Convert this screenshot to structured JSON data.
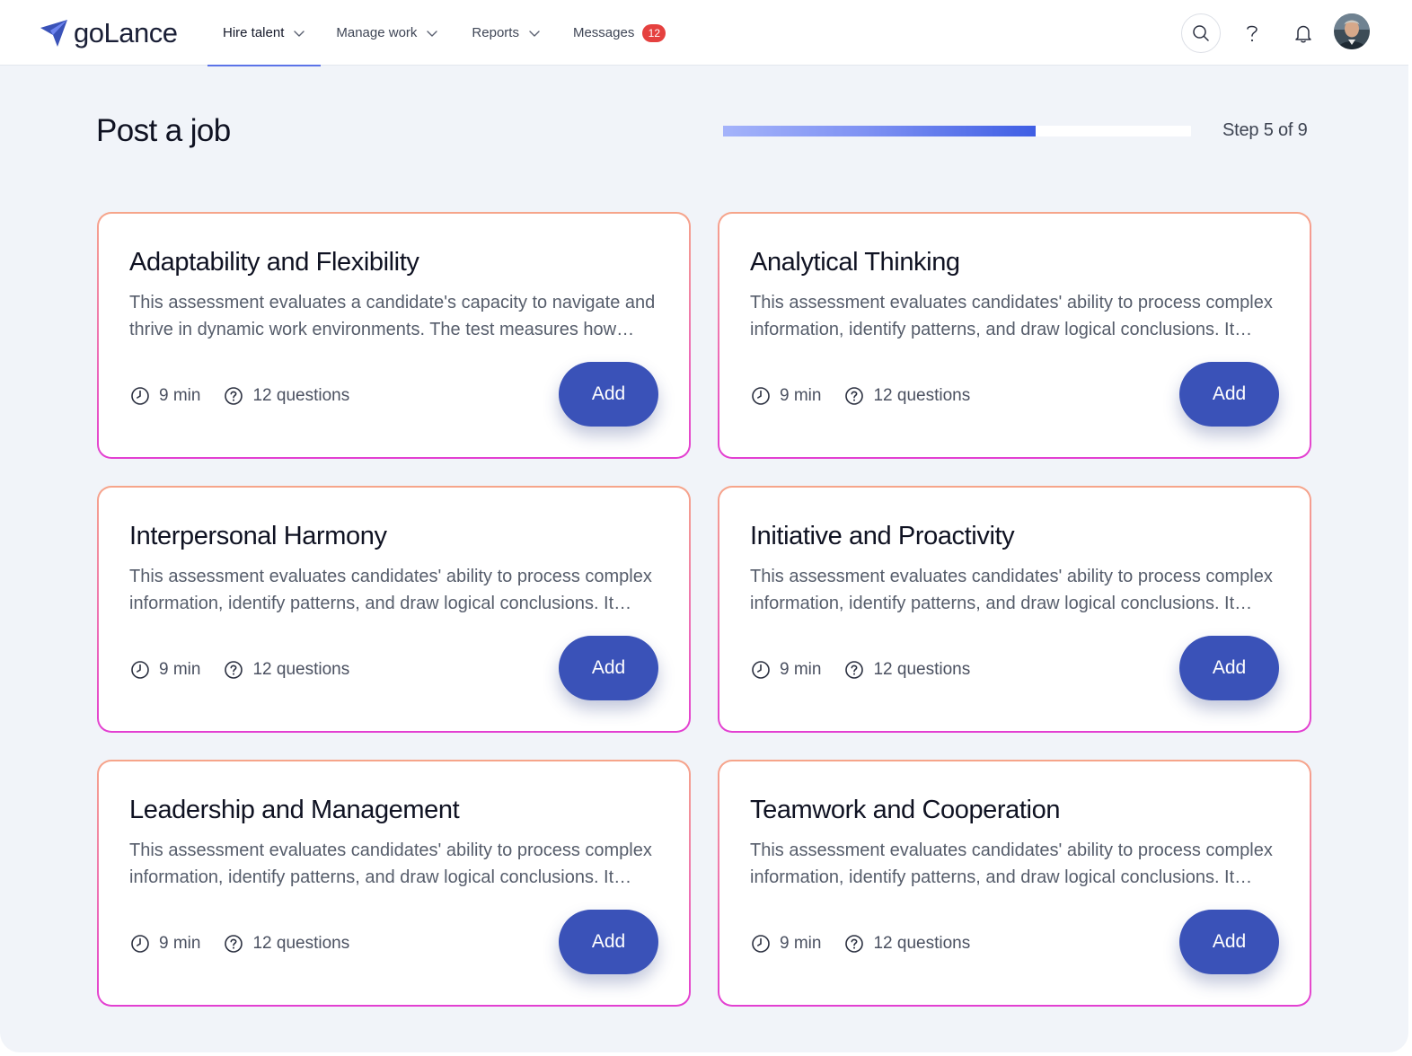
{
  "brand": {
    "name": "goLance",
    "accent": "#3a52b8"
  },
  "nav": {
    "items": [
      {
        "label": "Hire talent",
        "active": true,
        "dropdown": true
      },
      {
        "label": "Manage work",
        "dropdown": true
      },
      {
        "label": "Reports",
        "dropdown": true
      },
      {
        "label": "Messages",
        "badge": "12"
      }
    ]
  },
  "header_icons": [
    "search-icon",
    "help-icon",
    "bell-icon",
    "avatar"
  ],
  "page": {
    "title": "Post a job",
    "step_label": "Step 5 of 9",
    "progress_fraction": 0.667
  },
  "cards": [
    {
      "title": "Adaptability and Flexibility",
      "description": "This assessment evaluates a candidate's capacity to navigate and thrive in dynamic work environments. The test measures how individuals adapt to change.",
      "duration": "9 min",
      "questions": "12 questions",
      "button": "Add"
    },
    {
      "title": "Analytical Thinking",
      "description": "This assessment evaluates candidates' ability to process complex information, identify patterns, and draw logical conclusions. It measures reasoning skills.",
      "duration": "9 min",
      "questions": "12 questions",
      "button": "Add"
    },
    {
      "title": "Interpersonal Harmony",
      "description": "This assessment evaluates candidates' ability to process complex information, identify patterns, and draw logical conclusions. It measures reasoning skills.",
      "duration": "9 min",
      "questions": "12 questions",
      "button": "Add"
    },
    {
      "title": "Initiative and Proactivity",
      "description": "This assessment evaluates candidates' ability to process complex information, identify patterns, and draw logical conclusions. It measures reasoning skills.",
      "duration": "9 min",
      "questions": "12 questions",
      "button": "Add"
    },
    {
      "title": "Leadership and Management",
      "description": "This assessment evaluates candidates' ability to process complex information, identify patterns, and draw logical conclusions. It measures reasoning skills.",
      "duration": "9 min",
      "questions": "12 questions",
      "button": "Add"
    },
    {
      "title": "Teamwork and Cooperation",
      "description": "This assessment evaluates candidates' ability to process complex information, identify patterns, and draw logical conclusions. It measures reasoning skills.",
      "duration": "9 min",
      "questions": "12 questions",
      "button": "Add"
    }
  ]
}
